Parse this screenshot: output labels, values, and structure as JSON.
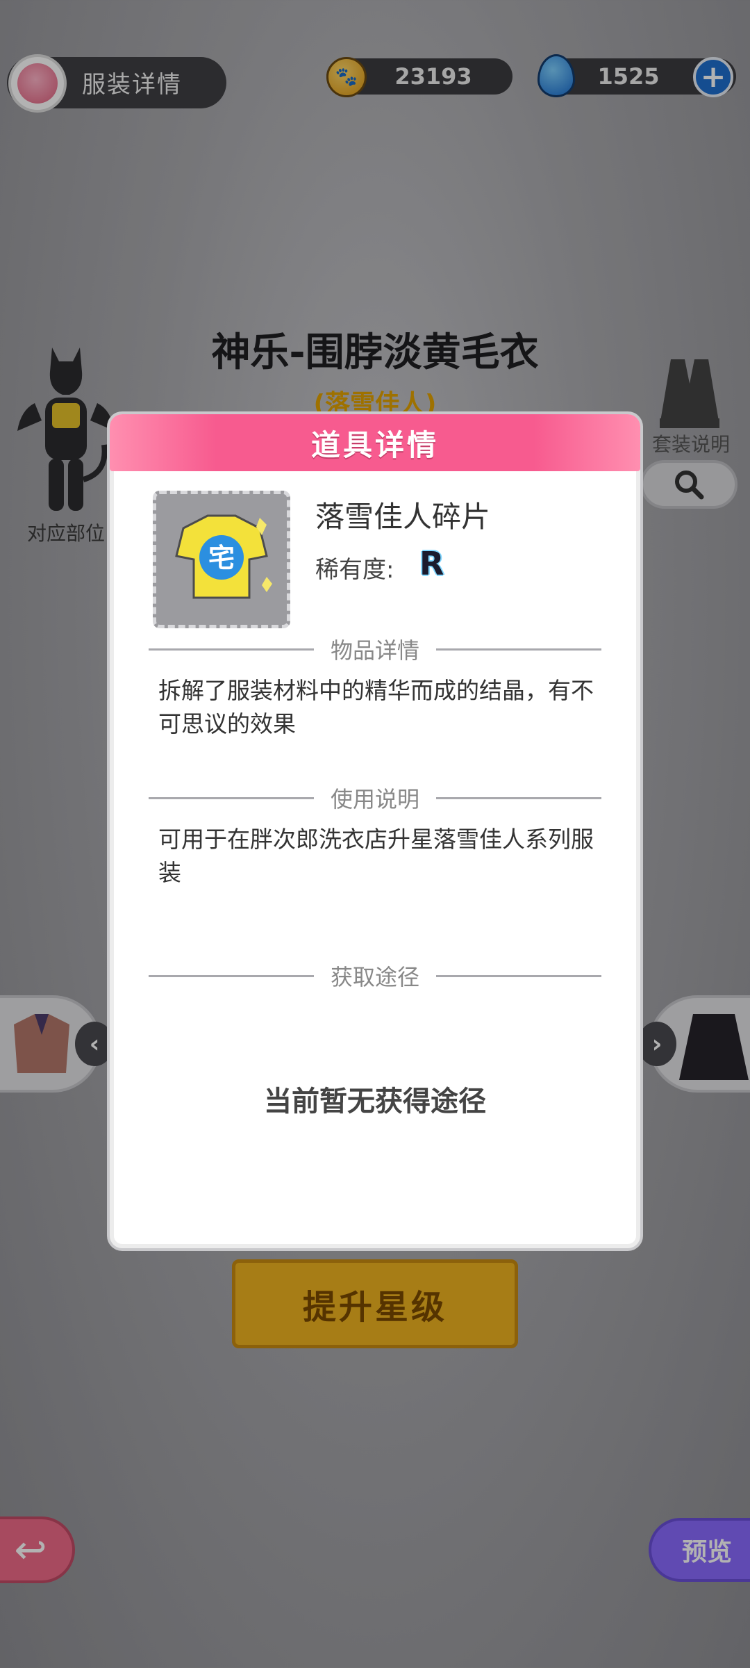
{
  "header": {
    "title": "服装详情",
    "coins": "23193",
    "gems": "1525"
  },
  "outfit": {
    "name": "神乐-围脖淡黄毛衣",
    "set_name": "(落雪佳人)",
    "slot_label": "对应部位",
    "set_desc_label": "套装说明",
    "upgrade_label": "提升星级",
    "preview_label": "预览"
  },
  "modal": {
    "title": "道具详情",
    "item_name": "落雪佳人碎片",
    "rarity_label": "稀有度:",
    "rarity_value": "R",
    "details_heading": "物品详情",
    "details_text": "拆解了服装材料中的精华而成的结晶，有不可思议的效果",
    "usage_heading": "使用说明",
    "usage_text": "可用于在胖次郎洗衣店升星落雪佳人系列服装",
    "source_heading": "获取途径",
    "source_text": "当前暂无获得途径"
  },
  "colors": {
    "modal_header": "#f75b8f",
    "set_name": "#e3a300",
    "upgrade_button": "#f0b420",
    "preview_button": "#8a6bff",
    "back_button": "#f06b89"
  },
  "icons": {
    "coin": "paw-coin-icon",
    "gem": "blue-gem-icon",
    "plus": "plus-icon",
    "search": "search-icon",
    "back": "back-arrow-icon"
  }
}
